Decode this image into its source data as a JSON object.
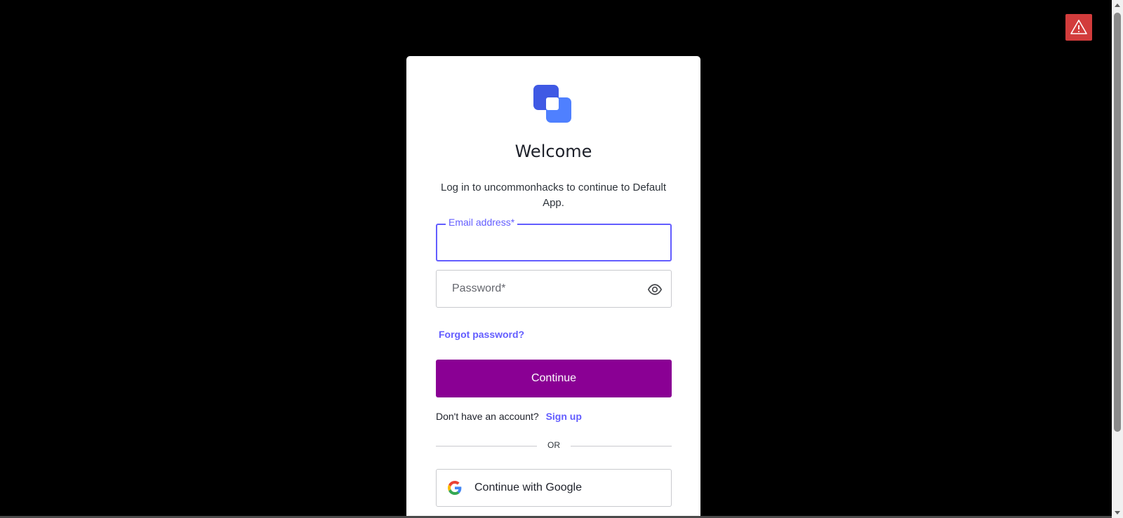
{
  "login": {
    "title": "Welcome",
    "subtitle": "Log in to uncommonhacks to continue to Default App.",
    "email_label": "Email address*",
    "email_value": "",
    "password_placeholder": "Password*",
    "password_value": "",
    "forgot_password": "Forgot password?",
    "continue_label": "Continue",
    "no_account_text": "Don't have an account?",
    "signup_label": "Sign up",
    "or_text": "OR",
    "google_label": "Continue with Google"
  },
  "icons": {
    "logo": "app-logo",
    "eye": "eye-icon",
    "google": "google-icon",
    "warning": "warning-icon"
  },
  "colors": {
    "accent": "#635dff",
    "continue_button": "#8a0094",
    "logo_blue": "#3f59e4",
    "warning": "#d23c3c"
  }
}
